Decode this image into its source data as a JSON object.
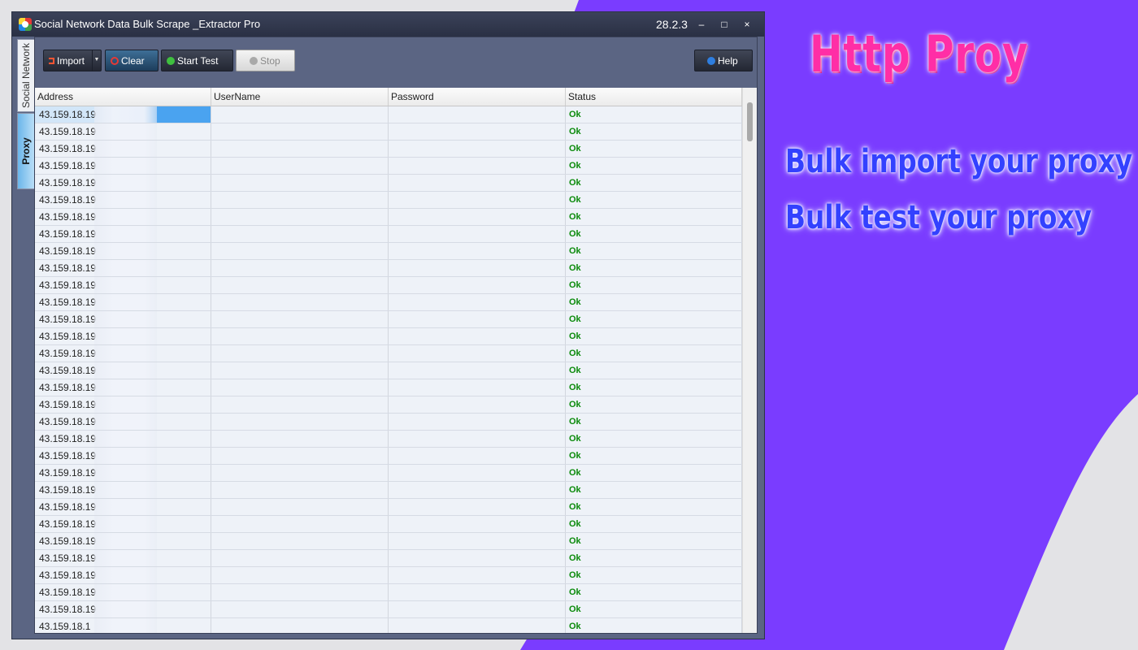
{
  "colors": {
    "background": "#e3e3e6",
    "purple_shape": "#7a3cff",
    "window_bg": "#5b6583",
    "status_ok": "#0a8a0a",
    "promo_heading": "#ff2ea6",
    "promo_lines": "#3341ff"
  },
  "window": {
    "title": "Social Network Data Bulk Scrape _Extractor Pro",
    "version": "28.2.3",
    "app_icon": "app-logo-icon",
    "controls": {
      "minimize": "–",
      "maximize": "□",
      "close": "×"
    }
  },
  "side_tabs": [
    {
      "label": "Social Network",
      "active": false
    },
    {
      "label": "Proxy",
      "active": true
    }
  ],
  "toolbar": {
    "import_label": "Import",
    "clear_label": "Clear",
    "start_test_label": "Start Test",
    "stop_label": "Stop",
    "help_label": "Help"
  },
  "grid": {
    "columns": [
      "Address",
      "UserName",
      "Password",
      "Status"
    ],
    "rows": [
      {
        "address": "43.159.18.19",
        "username": "",
        "password": "",
        "status": "Ok"
      },
      {
        "address": "43.159.18.19",
        "username": "",
        "password": "",
        "status": "Ok"
      },
      {
        "address": "43.159.18.19",
        "username": "",
        "password": "",
        "status": "Ok"
      },
      {
        "address": "43.159.18.19",
        "username": "",
        "password": "",
        "status": "Ok"
      },
      {
        "address": "43.159.18.19",
        "username": "",
        "password": "",
        "status": "Ok"
      },
      {
        "address": "43.159.18.19",
        "username": "",
        "password": "",
        "status": "Ok"
      },
      {
        "address": "43.159.18.19",
        "username": "",
        "password": "",
        "status": "Ok"
      },
      {
        "address": "43.159.18.19",
        "username": "",
        "password": "",
        "status": "Ok"
      },
      {
        "address": "43.159.18.19",
        "username": "",
        "password": "",
        "status": "Ok"
      },
      {
        "address": "43.159.18.19",
        "username": "",
        "password": "",
        "status": "Ok"
      },
      {
        "address": "43.159.18.19",
        "username": "",
        "password": "",
        "status": "Ok"
      },
      {
        "address": "43.159.18.19",
        "username": "",
        "password": "",
        "status": "Ok"
      },
      {
        "address": "43.159.18.19",
        "username": "",
        "password": "",
        "status": "Ok"
      },
      {
        "address": "43.159.18.19",
        "username": "",
        "password": "",
        "status": "Ok"
      },
      {
        "address": "43.159.18.19",
        "username": "",
        "password": "",
        "status": "Ok"
      },
      {
        "address": "43.159.18.19",
        "username": "",
        "password": "",
        "status": "Ok"
      },
      {
        "address": "43.159.18.19",
        "username": "",
        "password": "",
        "status": "Ok"
      },
      {
        "address": "43.159.18.19",
        "username": "",
        "password": "",
        "status": "Ok"
      },
      {
        "address": "43.159.18.19",
        "username": "",
        "password": "",
        "status": "Ok"
      },
      {
        "address": "43.159.18.19",
        "username": "",
        "password": "",
        "status": "Ok"
      },
      {
        "address": "43.159.18.19",
        "username": "",
        "password": "",
        "status": "Ok"
      },
      {
        "address": "43.159.18.19",
        "username": "",
        "password": "",
        "status": "Ok"
      },
      {
        "address": "43.159.18.19",
        "username": "",
        "password": "",
        "status": "Ok"
      },
      {
        "address": "43.159.18.19",
        "username": "",
        "password": "",
        "status": "Ok"
      },
      {
        "address": "43.159.18.19",
        "username": "",
        "password": "",
        "status": "Ok"
      },
      {
        "address": "43.159.18.19",
        "username": "",
        "password": "",
        "status": "Ok"
      },
      {
        "address": "43.159.18.19",
        "username": "",
        "password": "",
        "status": "Ok"
      },
      {
        "address": "43.159.18.19",
        "username": "",
        "password": "",
        "status": "Ok"
      },
      {
        "address": "43.159.18.19",
        "username": "",
        "password": "",
        "status": "Ok"
      },
      {
        "address": "43.159.18.19",
        "username": "",
        "password": "",
        "status": "Ok"
      },
      {
        "address": "43.159.18.1",
        "username": "",
        "password": "",
        "status": "Ok"
      }
    ]
  },
  "promo": {
    "heading": "Http Proy",
    "lines": [
      "Bulk import your proxy",
      "Bulk test your proxy"
    ]
  }
}
